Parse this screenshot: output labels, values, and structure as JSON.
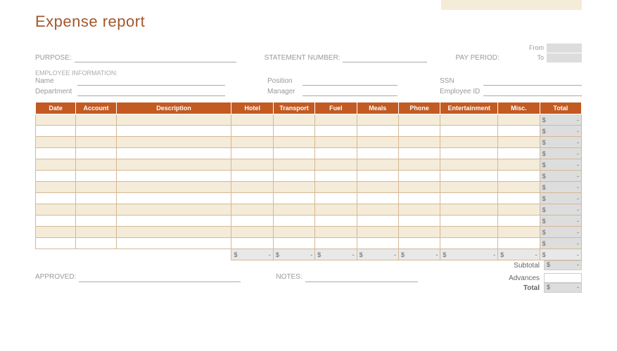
{
  "title": "Expense report",
  "fields": {
    "purpose": "PURPOSE:",
    "statement_number": "STATEMENT NUMBER:",
    "pay_period": "PAY PERIOD:",
    "from": "From",
    "to": "To",
    "emp_info": "EMPLOYEE INFORMATION:",
    "name": "Name",
    "position": "Position",
    "ssn": "SSN",
    "department": "Department",
    "manager": "Manager",
    "employee_id": "Employee ID",
    "approved": "APPROVED:",
    "notes": "NOTES:"
  },
  "columns": [
    "Date",
    "Account",
    "Description",
    "Hotel",
    "Transport",
    "Fuel",
    "Meals",
    "Phone",
    "Entertainment",
    "Misc.",
    "Total"
  ],
  "currency": "$",
  "dash": "-",
  "summary": {
    "subtotal": "Subtotal",
    "advances": "Advances",
    "total": "Total"
  },
  "row_count": 12
}
